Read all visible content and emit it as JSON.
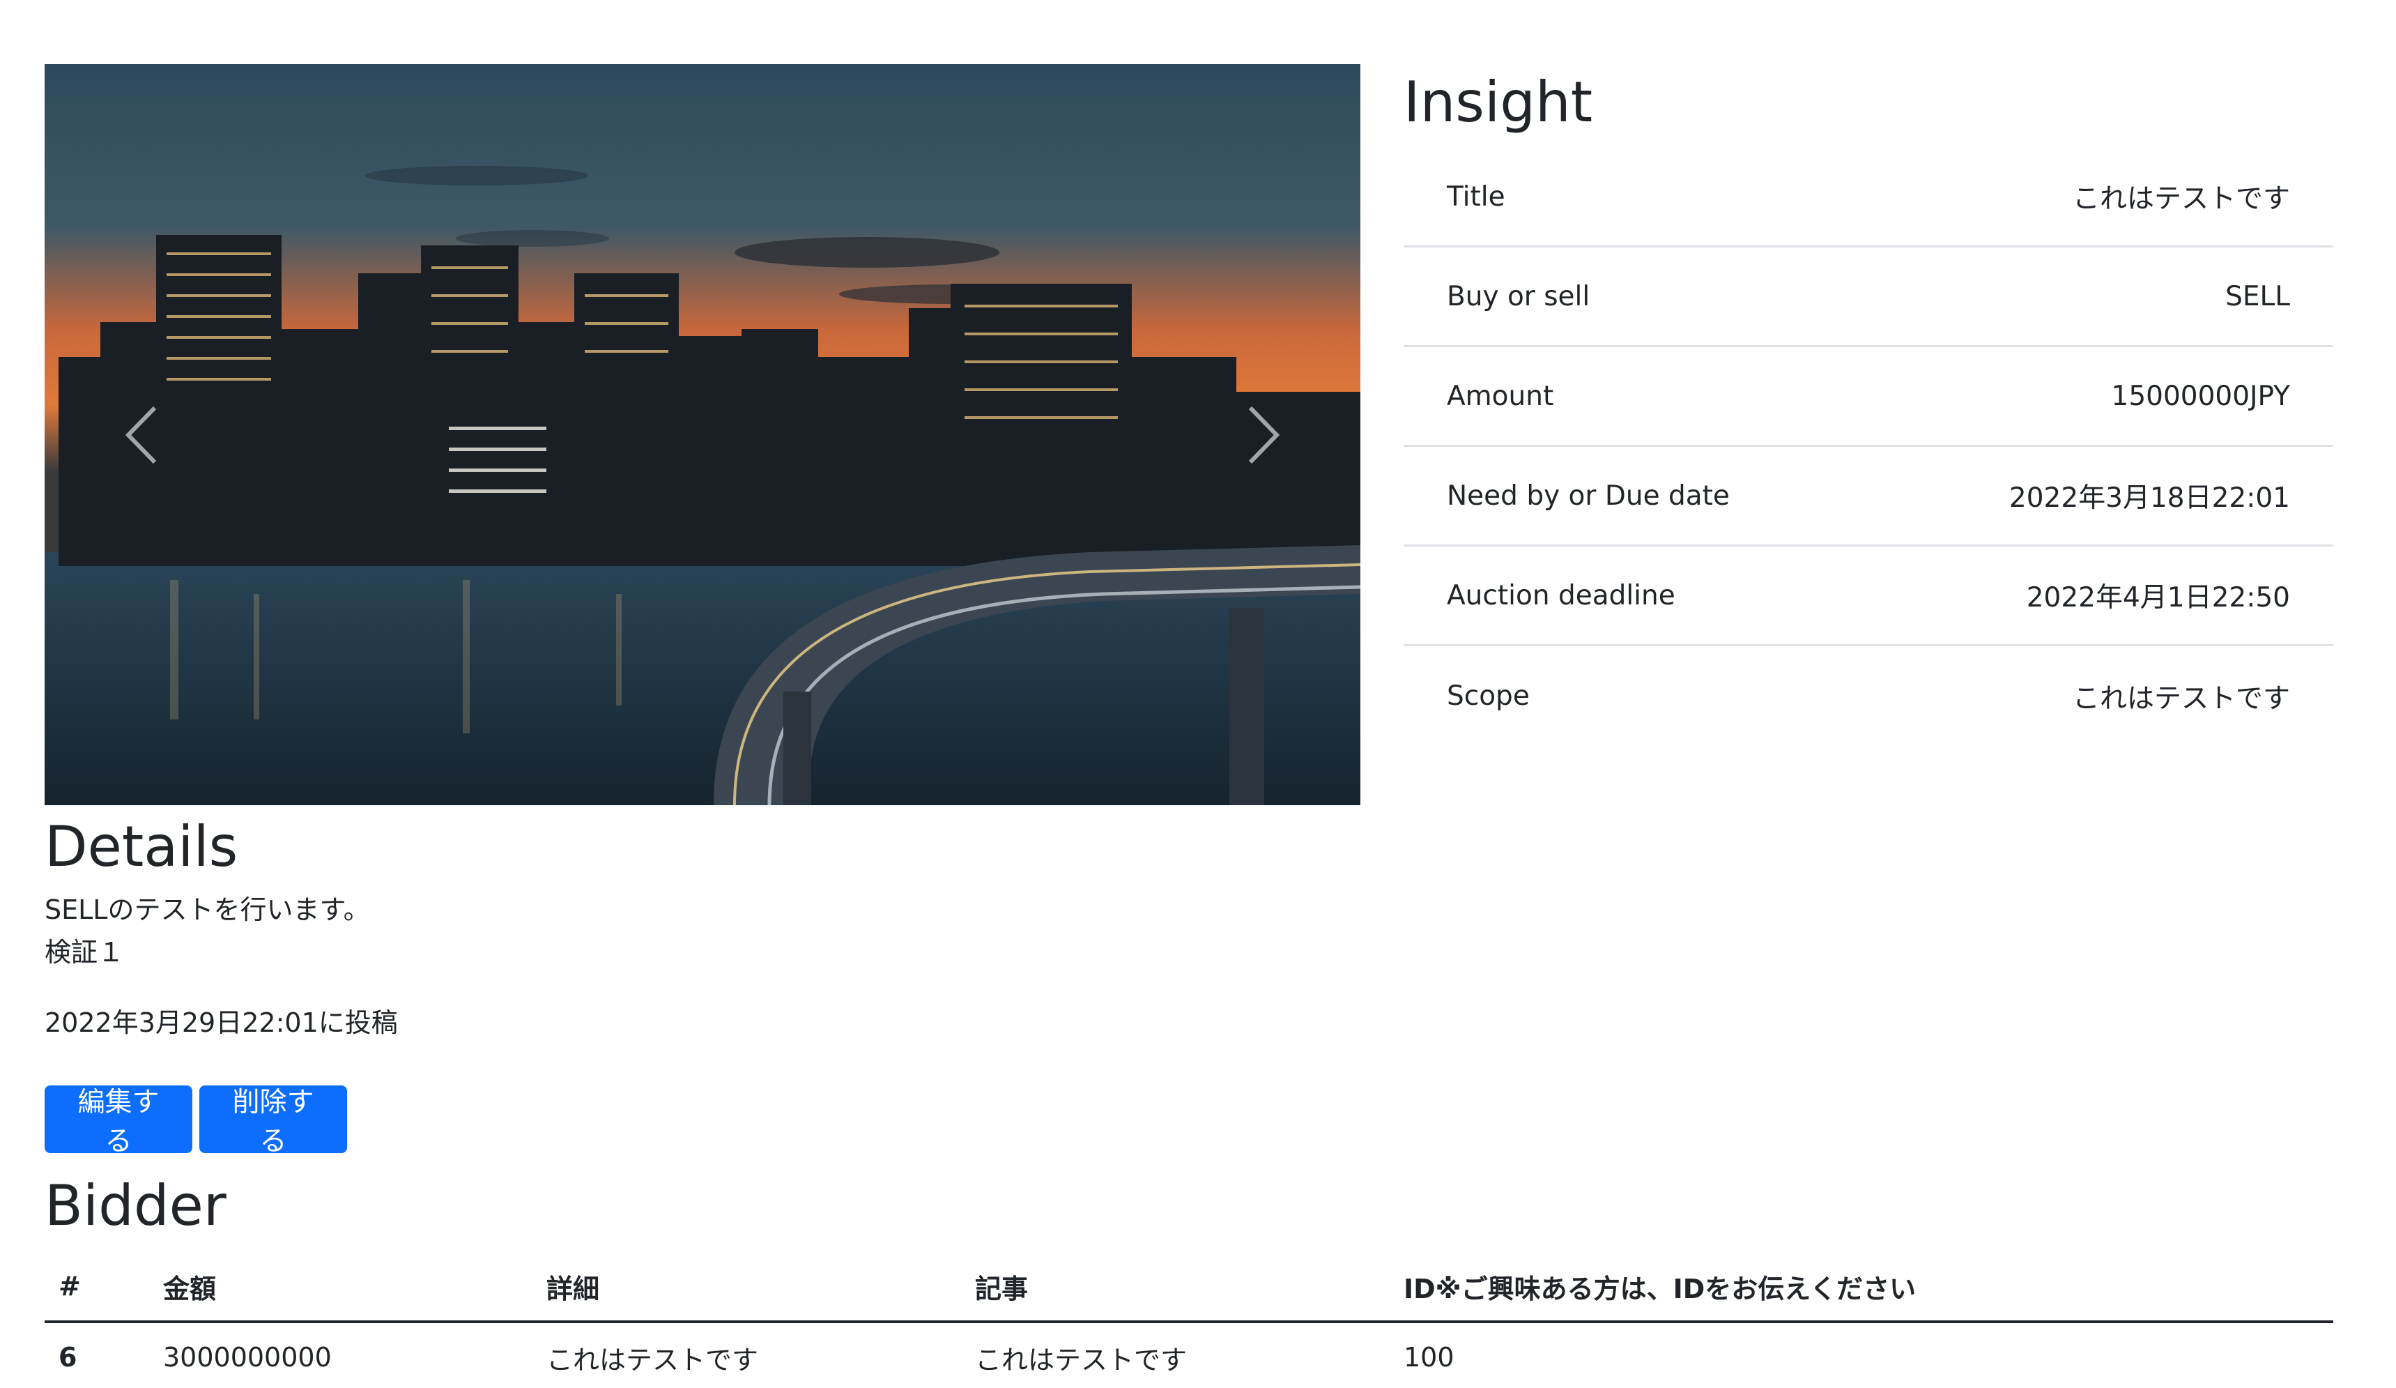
{
  "carousel": {
    "prev_icon": "chevron-left-icon",
    "next_icon": "chevron-right-icon"
  },
  "insight": {
    "title": "Insight",
    "rows": [
      {
        "label": "Title",
        "value": "これはテストです"
      },
      {
        "label": "Buy or sell",
        "value": "SELL"
      },
      {
        "label": "Amount",
        "value": "15000000JPY"
      },
      {
        "label": "Need by or Due date",
        "value": "2022年3月18日22:01"
      },
      {
        "label": "Auction deadline",
        "value": "2022年4月1日22:50"
      },
      {
        "label": "Scope",
        "value": "これはテストです"
      }
    ]
  },
  "details": {
    "title": "Details",
    "line1": "SELLのテストを行います。",
    "line2": "検証１",
    "posted": "2022年3月29日22:01に投稿"
  },
  "actions": {
    "edit_label": "編集する",
    "delete_label": "削除する"
  },
  "bidder": {
    "title": "Bidder",
    "headers": [
      "#",
      "金額",
      "詳細",
      "記事",
      "ID※ご興味ある方は、IDをお伝えください"
    ],
    "rows": [
      [
        "6",
        "3000000000",
        "これはテストです",
        "これはテストです",
        "100"
      ]
    ]
  },
  "colors": {
    "primary": "#0d6efd",
    "text": "#212529",
    "border": "#dee2e6"
  }
}
